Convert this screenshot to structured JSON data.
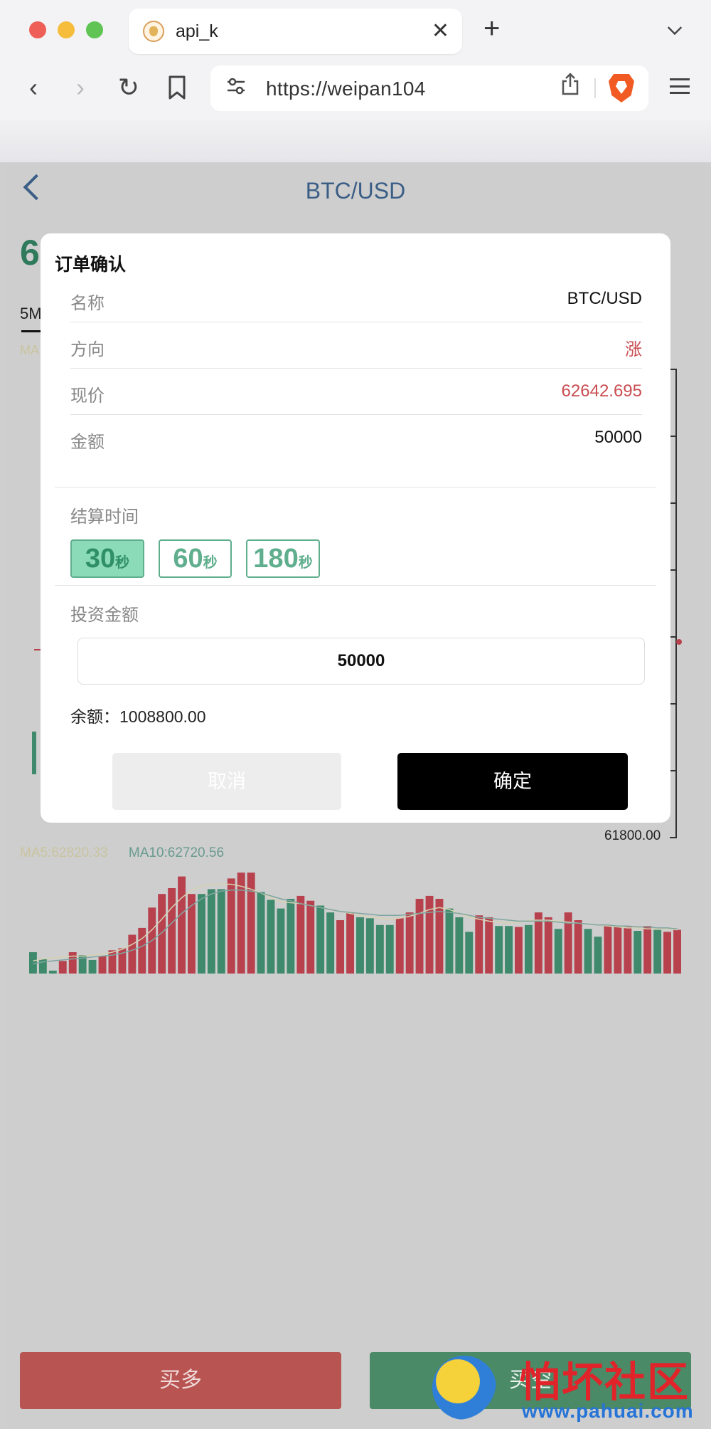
{
  "browser": {
    "tab_title": "api_k",
    "tab_close": "✕",
    "new_tab": "+",
    "url": "https://weipan104"
  },
  "page": {
    "title": "BTC/USD",
    "big_price_partial": "6",
    "period_tab": "5M",
    "ma_top_partial": "MA",
    "y_axis_bottom_label": "61800.00",
    "ma5_label": "MA5:62820.33",
    "ma10_label": "MA10:62720.56",
    "buy_up_label": "买多",
    "buy_down_label": "买空",
    "watermark_text": "怕坏社区",
    "watermark_url": "www.pahuai.com",
    "colors": {
      "up": "#b8414e",
      "down": "#3f8a6c"
    }
  },
  "volume_data": {
    "type": "bar",
    "bars": [
      {
        "v": 22,
        "c": "down"
      },
      {
        "v": 15,
        "c": "down"
      },
      {
        "v": 3,
        "c": "down"
      },
      {
        "v": 13,
        "c": "up"
      },
      {
        "v": 22,
        "c": "up"
      },
      {
        "v": 19,
        "c": "down"
      },
      {
        "v": 14,
        "c": "down"
      },
      {
        "v": 18,
        "c": "up"
      },
      {
        "v": 24,
        "c": "up"
      },
      {
        "v": 26,
        "c": "up"
      },
      {
        "v": 40,
        "c": "up"
      },
      {
        "v": 47,
        "c": "up"
      },
      {
        "v": 68,
        "c": "up"
      },
      {
        "v": 82,
        "c": "up"
      },
      {
        "v": 88,
        "c": "up"
      },
      {
        "v": 100,
        "c": "up"
      },
      {
        "v": 82,
        "c": "up"
      },
      {
        "v": 82,
        "c": "down"
      },
      {
        "v": 87,
        "c": "down"
      },
      {
        "v": 87,
        "c": "down"
      },
      {
        "v": 98,
        "c": "up"
      },
      {
        "v": 104,
        "c": "up"
      },
      {
        "v": 104,
        "c": "up"
      },
      {
        "v": 84,
        "c": "down"
      },
      {
        "v": 76,
        "c": "down"
      },
      {
        "v": 67,
        "c": "down"
      },
      {
        "v": 77,
        "c": "down"
      },
      {
        "v": 80,
        "c": "up"
      },
      {
        "v": 75,
        "c": "up"
      },
      {
        "v": 70,
        "c": "down"
      },
      {
        "v": 63,
        "c": "down"
      },
      {
        "v": 55,
        "c": "up"
      },
      {
        "v": 63,
        "c": "up"
      },
      {
        "v": 58,
        "c": "down"
      },
      {
        "v": 57,
        "c": "down"
      },
      {
        "v": 50,
        "c": "down"
      },
      {
        "v": 50,
        "c": "down"
      },
      {
        "v": 57,
        "c": "up"
      },
      {
        "v": 63,
        "c": "up"
      },
      {
        "v": 77,
        "c": "up"
      },
      {
        "v": 80,
        "c": "up"
      },
      {
        "v": 77,
        "c": "up"
      },
      {
        "v": 67,
        "c": "down"
      },
      {
        "v": 58,
        "c": "down"
      },
      {
        "v": 43,
        "c": "down"
      },
      {
        "v": 60,
        "c": "up"
      },
      {
        "v": 58,
        "c": "up"
      },
      {
        "v": 49,
        "c": "down"
      },
      {
        "v": 49,
        "c": "down"
      },
      {
        "v": 48,
        "c": "up"
      },
      {
        "v": 50,
        "c": "down"
      },
      {
        "v": 63,
        "c": "up"
      },
      {
        "v": 58,
        "c": "up"
      },
      {
        "v": 46,
        "c": "down"
      },
      {
        "v": 63,
        "c": "up"
      },
      {
        "v": 55,
        "c": "up"
      },
      {
        "v": 46,
        "c": "down"
      },
      {
        "v": 38,
        "c": "down"
      },
      {
        "v": 49,
        "c": "up"
      },
      {
        "v": 48,
        "c": "up"
      },
      {
        "v": 48,
        "c": "up"
      },
      {
        "v": 44,
        "c": "down"
      },
      {
        "v": 49,
        "c": "up"
      },
      {
        "v": 45,
        "c": "down"
      },
      {
        "v": 43,
        "c": "up"
      },
      {
        "v": 45,
        "c": "up"
      }
    ],
    "ma5": [
      13,
      15,
      16,
      17,
      18,
      18,
      19,
      20,
      22,
      25,
      30,
      36,
      45,
      56,
      68,
      78,
      86,
      90,
      92,
      92,
      92,
      90,
      87,
      83,
      78,
      74,
      73,
      72,
      70,
      68,
      66,
      64,
      62,
      60,
      58,
      57,
      56,
      57,
      59,
      62,
      66,
      68,
      66,
      62,
      58,
      56,
      54,
      53,
      52,
      53,
      55,
      55,
      55,
      54,
      53,
      52,
      51,
      50,
      49,
      48,
      47,
      47,
      46,
      46,
      46,
      45
    ],
    "ma10": [
      10,
      12,
      13,
      14,
      15,
      16,
      17,
      18,
      19,
      21,
      24,
      28,
      34,
      42,
      52,
      62,
      70,
      77,
      82,
      85,
      86,
      86,
      85,
      83,
      80,
      77,
      75,
      72,
      70,
      68,
      66,
      64,
      63,
      62,
      61,
      60,
      60,
      60,
      61,
      62,
      63,
      64,
      63,
      62,
      60,
      58,
      57,
      56,
      55,
      54,
      54,
      54,
      54,
      53,
      52,
      52,
      51,
      50,
      50,
      49,
      49,
      48,
      48,
      47,
      47,
      46
    ]
  },
  "modal": {
    "title": "订单确认",
    "rows": [
      {
        "label": "名称",
        "value": "BTC/USD"
      },
      {
        "label": "方向",
        "value": "涨"
      },
      {
        "label": "现价",
        "value": "62642.695"
      },
      {
        "label": "金额",
        "value": "50000"
      }
    ],
    "settle_label": "结算时间",
    "time_options": [
      {
        "num": "30",
        "unit": "秒"
      },
      {
        "num": "60",
        "unit": "秒"
      },
      {
        "num": "180",
        "unit": "秒"
      }
    ],
    "selected_time_index": 0,
    "invest_label": "投资金额",
    "invest_value": "50000",
    "balance": "余额：1008800.00",
    "cancel": "取消",
    "confirm": "确定"
  }
}
